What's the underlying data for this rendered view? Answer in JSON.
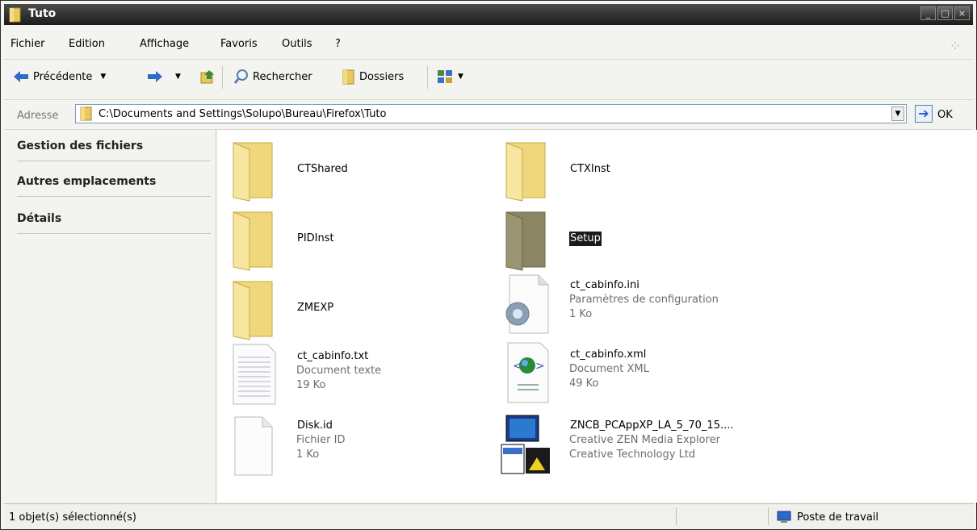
{
  "window": {
    "title": "Tuto"
  },
  "menu": [
    "Fichier",
    "Edition",
    "Affichage",
    "Favoris",
    "Outils",
    "?"
  ],
  "toolbar": {
    "back": "Précédente",
    "search": "Rechercher",
    "folders": "Dossiers"
  },
  "address": {
    "label": "Adresse",
    "path": "C:\\Documents and Settings\\Solupo\\Bureau\\Firefox\\Tuto",
    "go": "OK"
  },
  "tasks": [
    "Gestion des fichiers",
    "Autres emplacements",
    "Détails"
  ],
  "files": [
    {
      "name": "CTShared",
      "line2": "",
      "line3": "",
      "icon": "folder-icon"
    },
    {
      "name": "CTXInst",
      "line2": "",
      "line3": "",
      "icon": "folder-icon"
    },
    {
      "name": "PIDInst",
      "line2": "",
      "line3": "",
      "icon": "folder-icon"
    },
    {
      "name": "Setup",
      "line2": "",
      "line3": "",
      "icon": "folder-icon",
      "selected": true
    },
    {
      "name": "ZMEXP",
      "line2": "",
      "line3": "",
      "icon": "folder-icon"
    },
    {
      "name": "ct_cabinfo.ini",
      "line2": "Paramètres de configuration",
      "line3": "1 Ko",
      "icon": "ini-settings-icon"
    },
    {
      "name": "ct_cabinfo.txt",
      "line2": "Document texte",
      "line3": "19 Ko",
      "icon": "text-document-icon"
    },
    {
      "name": "ct_cabinfo.xml",
      "line2": "Document XML",
      "line3": "49 Ko",
      "icon": "xml-document-icon"
    },
    {
      "name": "Disk.id",
      "line2": "Fichier ID",
      "line3": "1 Ko",
      "icon": "blank-document-icon"
    },
    {
      "name": "ZNCB_PCAppXP_LA_5_70_15....",
      "line2": "Creative ZEN Media Explorer",
      "line3": "Creative Technology Ltd",
      "icon": "installer-app-icon"
    }
  ],
  "status": {
    "left": "1 objet(s) sélectionné(s)",
    "right": "Poste de travail"
  }
}
